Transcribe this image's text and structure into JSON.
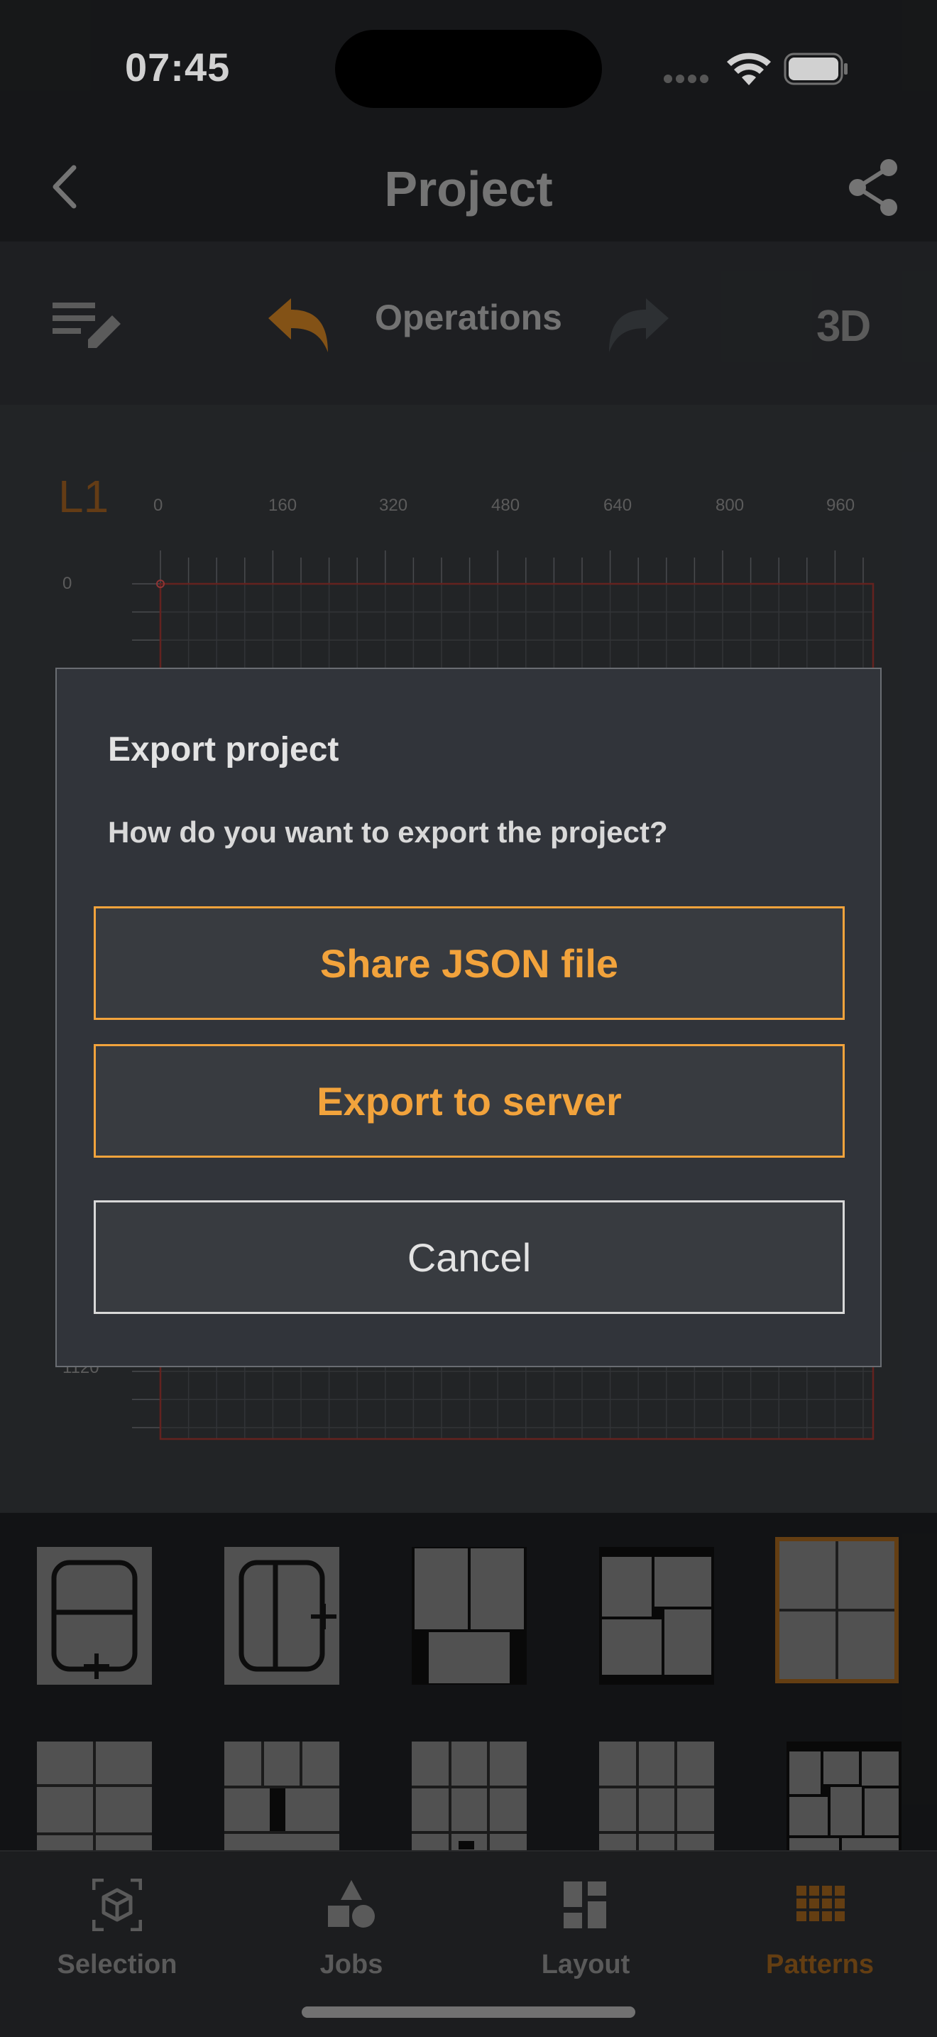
{
  "status_bar": {
    "time": "07:45"
  },
  "header": {
    "title": "Project"
  },
  "toolbar": {
    "title": "Operations",
    "mode_3d": "3D"
  },
  "canvas": {
    "layer": "L1",
    "x_ticks": [
      "0",
      "160",
      "320",
      "480",
      "640",
      "800",
      "960"
    ],
    "y_ticks": [
      "0",
      "1120"
    ]
  },
  "dialog": {
    "title": "Export project",
    "message": "How do you want to export the project?",
    "share_json_label": "Share JSON file",
    "export_server_label": "Export to server",
    "cancel_label": "Cancel"
  },
  "tabs": [
    {
      "label": "Selection",
      "icon": "cube-icon",
      "active": false
    },
    {
      "label": "Jobs",
      "icon": "shapes-icon",
      "active": false
    },
    {
      "label": "Layout",
      "icon": "layout-icon",
      "active": false
    },
    {
      "label": "Patterns",
      "icon": "grid-icon",
      "active": true
    }
  ],
  "colors": {
    "accent": "#f2a33c",
    "active_tab": "#7a4c16"
  }
}
